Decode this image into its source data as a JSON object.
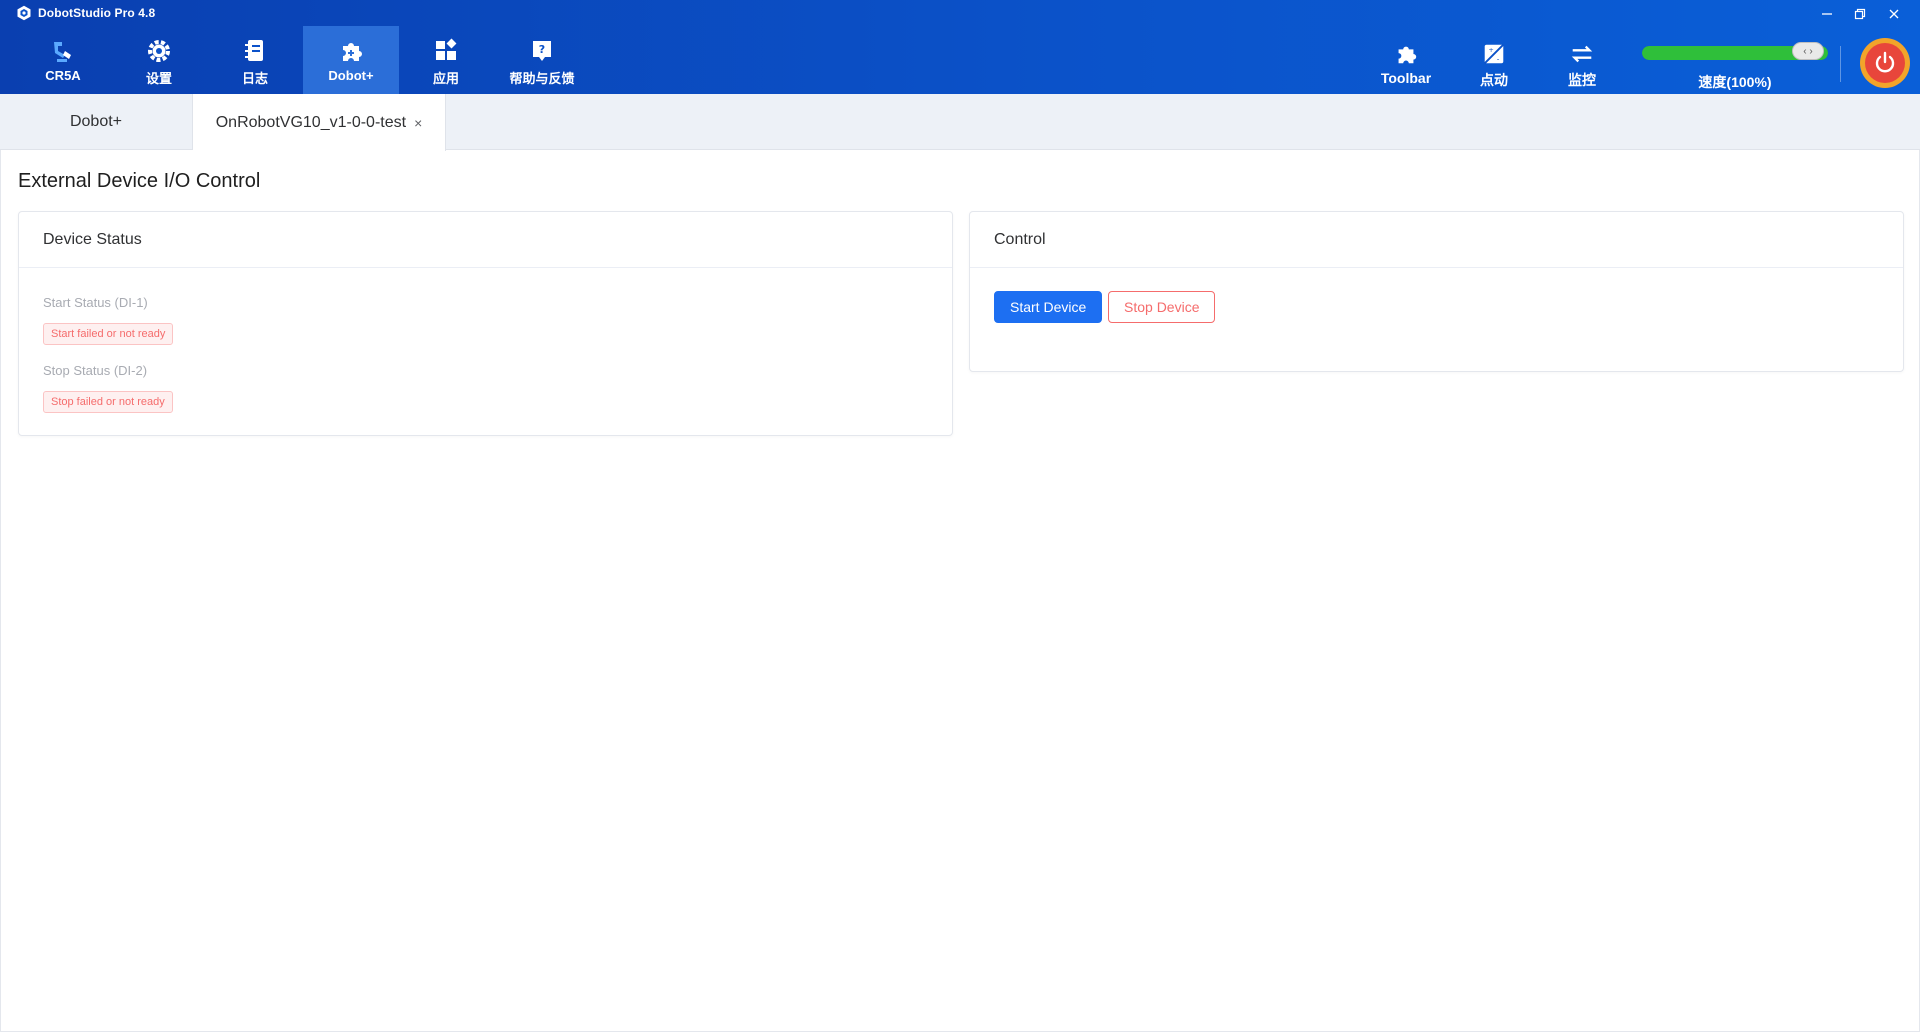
{
  "window": {
    "title": "DobotStudio Pro 4.8"
  },
  "nav": {
    "items": [
      {
        "label": "CR5A",
        "icon": "robot-arm-icon"
      },
      {
        "label": "设置",
        "icon": "gear-icon"
      },
      {
        "label": "日志",
        "icon": "log-book-icon"
      },
      {
        "label": "Dobot+",
        "icon": "puzzle-icon",
        "active": true
      },
      {
        "label": "应用",
        "icon": "apps-icon"
      },
      {
        "label": "帮助与反馈",
        "icon": "help-icon"
      }
    ],
    "right_items": [
      {
        "label": "Toolbar",
        "icon": "puzzle-icon"
      },
      {
        "label": "点动",
        "icon": "jog-icon"
      },
      {
        "label": "监控",
        "icon": "transfer-arrows-icon"
      }
    ],
    "speed": {
      "label": "速度(100%)",
      "value_percent": 100,
      "thumb_glyph": "‹ ›"
    }
  },
  "tabs": [
    {
      "label": "Dobot+"
    },
    {
      "label": "OnRobotVG10_v1-0-0-test",
      "close_glyph": "×"
    }
  ],
  "page": {
    "title": "External Device I/O Control",
    "device_status": {
      "header": "Device Status",
      "start_label": "Start Status (DI-1)",
      "start_tag": "Start failed or not ready",
      "stop_label": "Stop Status (DI-2)",
      "stop_tag": "Stop failed or not ready"
    },
    "control": {
      "header": "Control",
      "start_button": "Start Device",
      "stop_button": "Stop Device"
    }
  },
  "colors": {
    "nav_bg": "#0b52c9",
    "active_nav": "#2b6ed8",
    "primary": "#1d6ff2",
    "danger": "#f56c6c",
    "speed_fill": "#2fbf3a"
  }
}
